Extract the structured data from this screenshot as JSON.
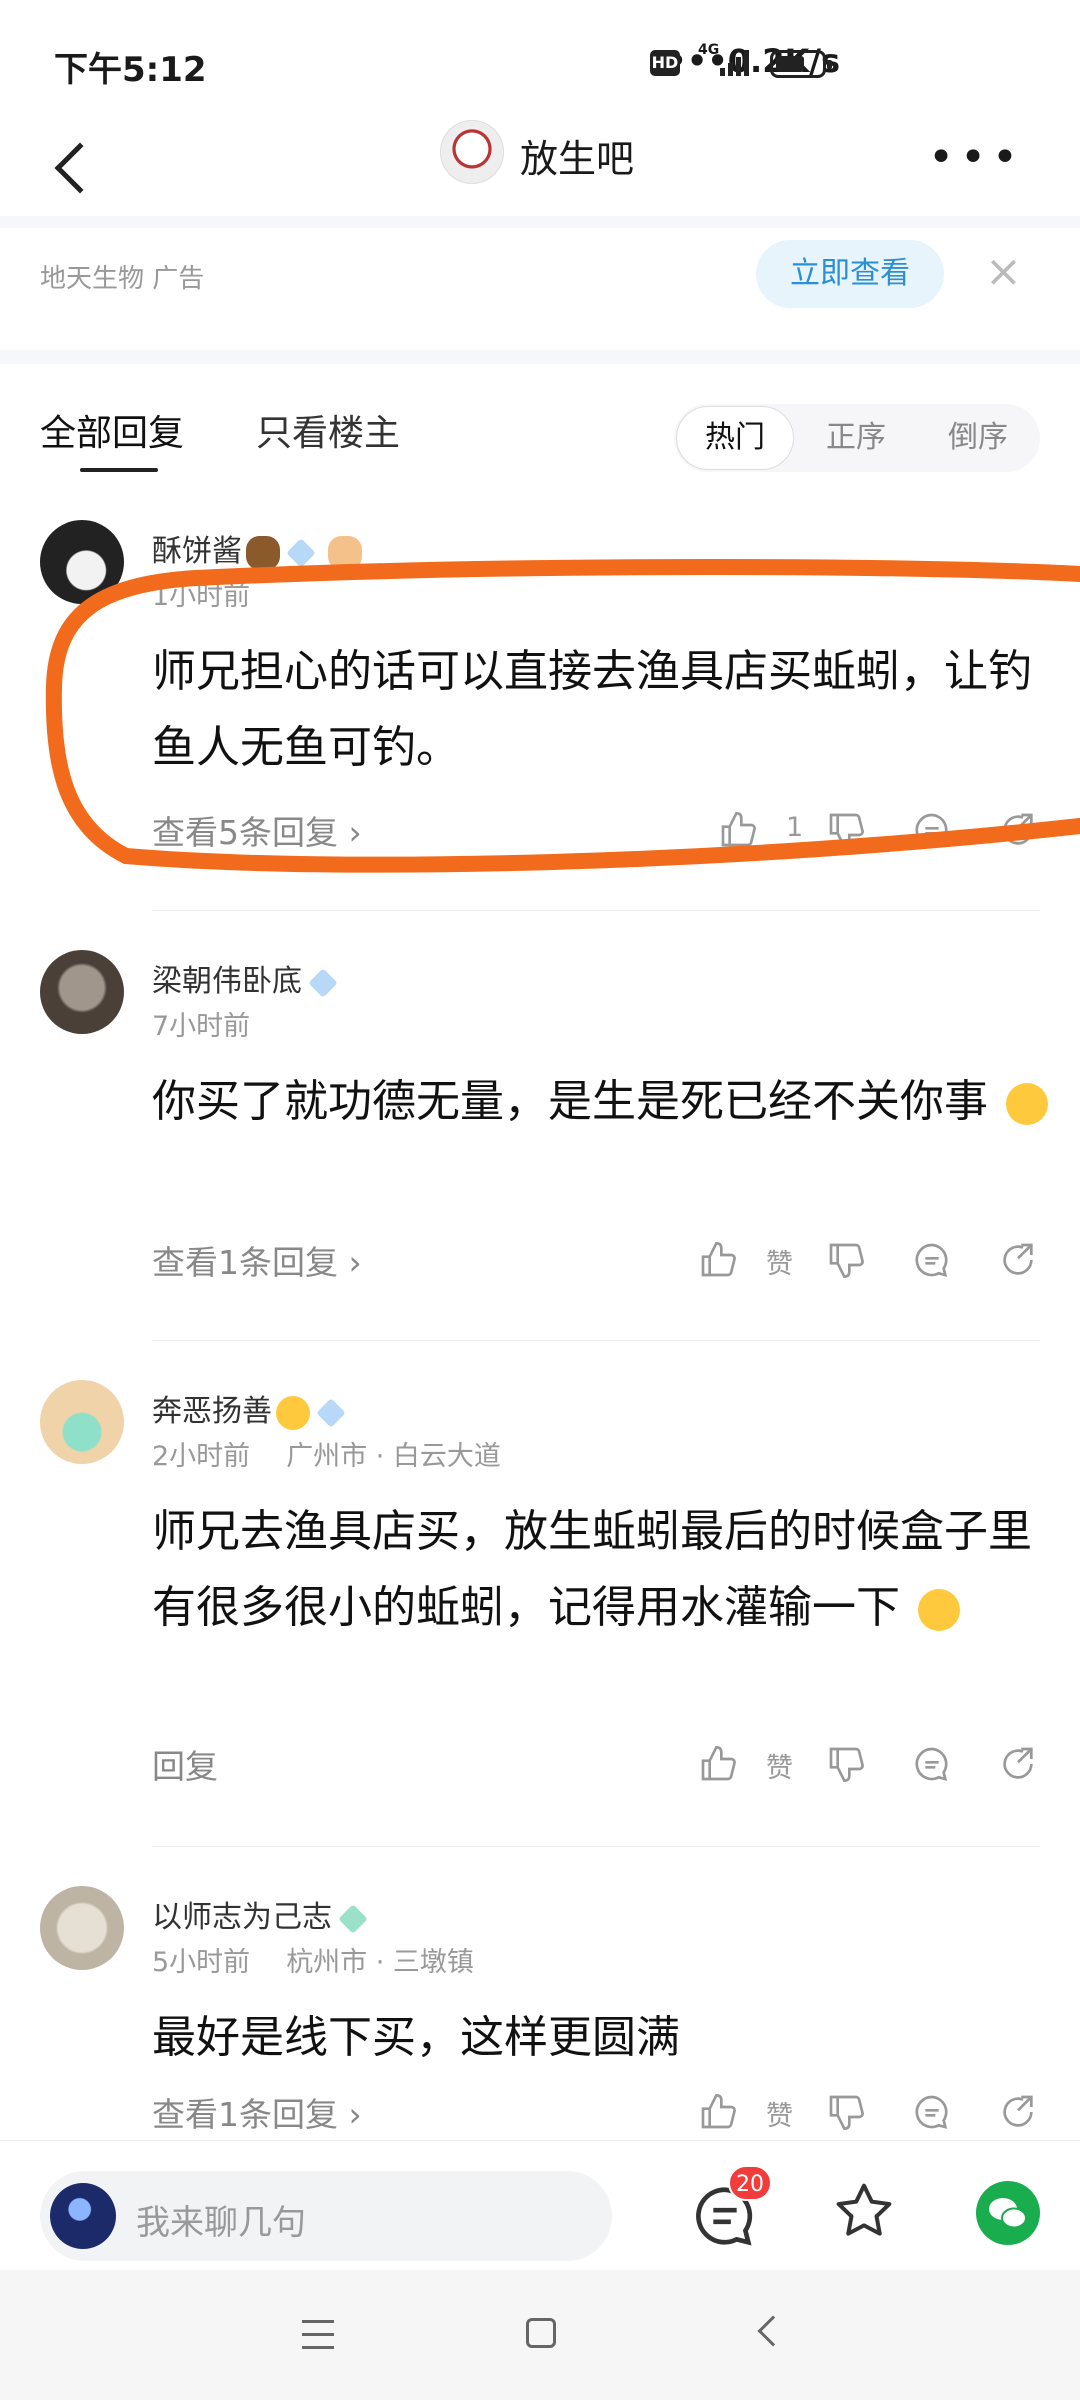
{
  "status_bar": {
    "time": "下午5:12",
    "speed": "•••0.2K/s",
    "hd": "HD",
    "network": "4G"
  },
  "nav": {
    "title": "放生吧"
  },
  "ad": {
    "source": "地天生物  广告",
    "cta_label": "立即查看"
  },
  "tabs": {
    "all": "全部回复",
    "owner_only": "只看楼主"
  },
  "sort": {
    "hot": "热门",
    "asc": "正序",
    "desc": "倒序"
  },
  "comments": [
    {
      "author": "酥饼酱",
      "time": "1小时前",
      "text": "师兄担心的话可以直接去渔具店买蚯蚓，让钓鱼人无鱼可钓。",
      "replies": "查看5条回复 ›",
      "likes": "1"
    },
    {
      "author": "梁朝伟卧底",
      "time": "7小时前",
      "text": "你买了就功德无量，是生是死已经不关你事",
      "replies": "查看1条回复 ›",
      "likes": "赞"
    },
    {
      "author": "奔恶扬善",
      "time": "2小时前",
      "location": "广州市 · 白云大道",
      "text": "师兄去渔具店买，放生蚯蚓最后的时候盒子里有很多很小的蚯蚓，记得用水灌输一下",
      "replies": "回复",
      "likes": "赞"
    },
    {
      "author": "以师志为己志",
      "time": "5小时前",
      "location": "杭州市 · 三墩镇",
      "text": "最好是线下买，这样更圆满",
      "replies": "查看1条回复 ›",
      "likes": "赞"
    }
  ],
  "bottom": {
    "placeholder": "我来聊几句",
    "comment_count": "20"
  },
  "colors": {
    "accent_blue": "#2b8fd6",
    "annotation_orange": "#f26a1b",
    "badge_red": "#f23b3b",
    "wechat_green": "#1aad4e"
  }
}
